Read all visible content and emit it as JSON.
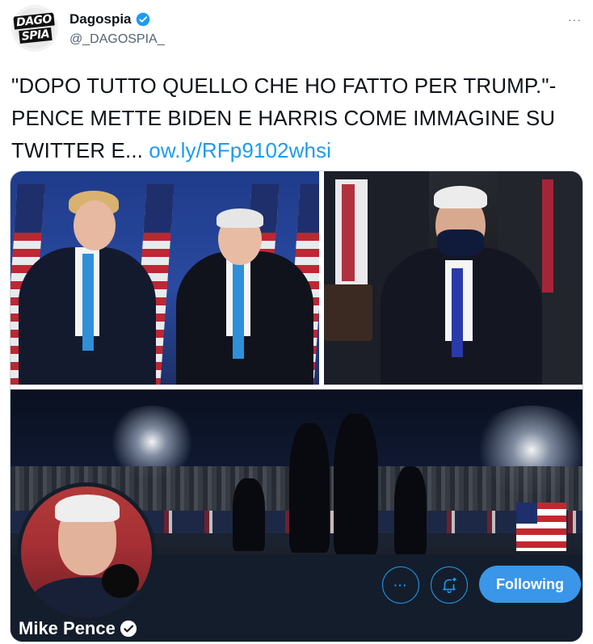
{
  "account": {
    "display_name": "Dagospia",
    "handle": "@_DAGOSPIA_",
    "logo_lines": [
      "DAGO",
      "SPIA"
    ],
    "verified_color": "#1d9bf0"
  },
  "tweet": {
    "text": "\"DOPO TUTTO QUELLO CHE HO FATTO PER TRUMP.\"- PENCE METTE BIDEN E HARRIS COME IMMAGINE SU TWITTER E... ",
    "link": "ow.ly/RFp9102whsi",
    "link_color": "#1d9bf0"
  },
  "more_menu": "···",
  "embedded_profile": {
    "name": "Mike Pence",
    "more_label": "···",
    "bell_icon": "bell-plus-icon",
    "following_label": "Following",
    "header_color": "#141d2b",
    "button_color": "#3a96e8"
  }
}
